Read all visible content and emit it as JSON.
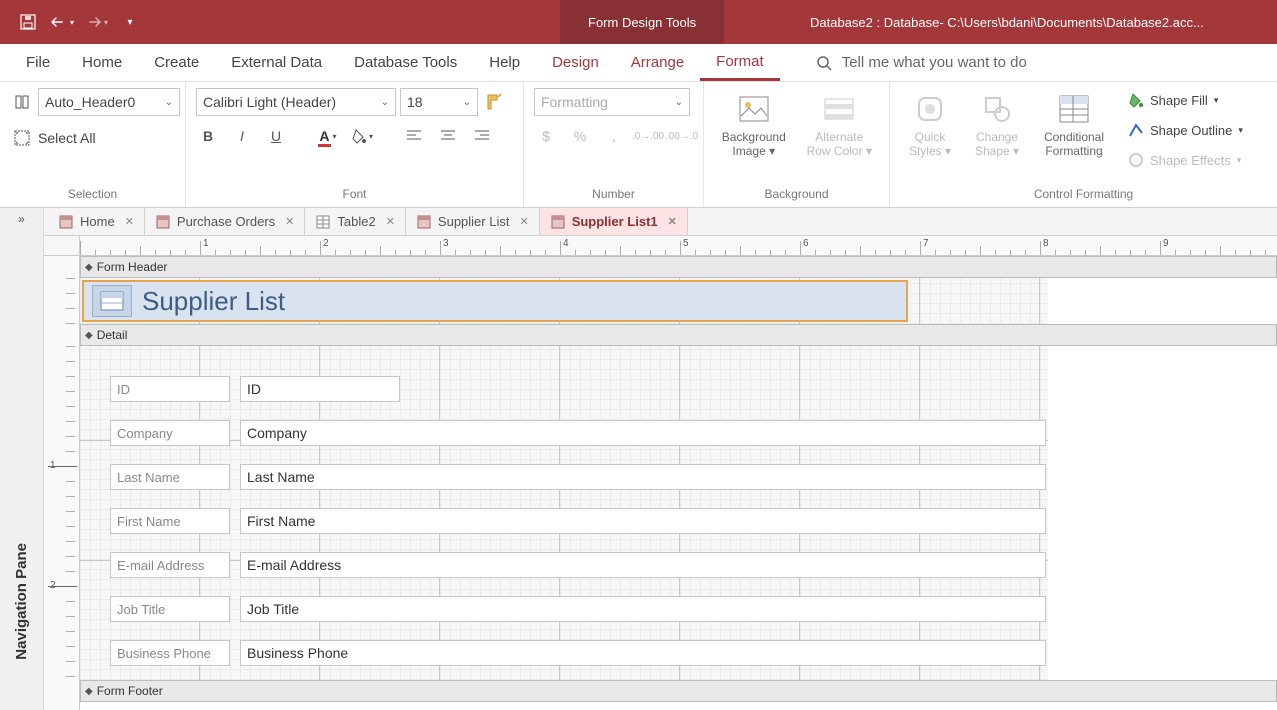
{
  "titlebar": {
    "tools_label": "Form Design Tools",
    "title": "Database2 : Database- C:\\Users\\bdani\\Documents\\Database2.acc..."
  },
  "tabs": {
    "file": "File",
    "home": "Home",
    "create": "Create",
    "external": "External Data",
    "dbtools": "Database Tools",
    "help": "Help",
    "design": "Design",
    "arrange": "Arrange",
    "format": "Format",
    "tellme": "Tell me what you want to do"
  },
  "ribbon": {
    "selection": {
      "object": "Auto_Header0",
      "select_all": "Select All",
      "label": "Selection"
    },
    "font": {
      "face": "Calibri Light (Header)",
      "size": "18",
      "label": "Font"
    },
    "number": {
      "format": "Formatting",
      "label": "Number"
    },
    "background": {
      "bg_image": "Background Image",
      "alt_row": "Alternate Row Color",
      "label": "Background"
    },
    "control_fmt": {
      "quick": "Quick Styles",
      "change_shape": "Change Shape",
      "conditional": "Conditional Formatting",
      "shape_fill": "Shape Fill",
      "shape_outline": "Shape Outline",
      "shape_effects": "Shape Effects",
      "label": "Control Formatting"
    }
  },
  "doc_tabs": [
    {
      "label": "Home"
    },
    {
      "label": "Purchase Orders"
    },
    {
      "label": "Table2"
    },
    {
      "label": "Supplier List"
    },
    {
      "label": "Supplier List1",
      "active": true
    }
  ],
  "form": {
    "header_section": "Form Header",
    "detail_section": "Detail",
    "footer_section": "Form Footer",
    "title": "Supplier List",
    "fields": [
      {
        "label": "ID",
        "control": "ID"
      },
      {
        "label": "Company",
        "control": "Company"
      },
      {
        "label": "Last Name",
        "control": "Last Name"
      },
      {
        "label": "First Name",
        "control": "First Name"
      },
      {
        "label": "E-mail Address",
        "control": "E-mail Address"
      },
      {
        "label": "Job Title",
        "control": "Job Title"
      },
      {
        "label": "Business Phone",
        "control": "Business Phone"
      }
    ]
  },
  "nav_pane_label": "Navigation Pane",
  "ruler_ticks_h": [
    1,
    2,
    3,
    4,
    5,
    6,
    7,
    8,
    9
  ],
  "ruler_ticks_v": [
    1,
    2
  ]
}
